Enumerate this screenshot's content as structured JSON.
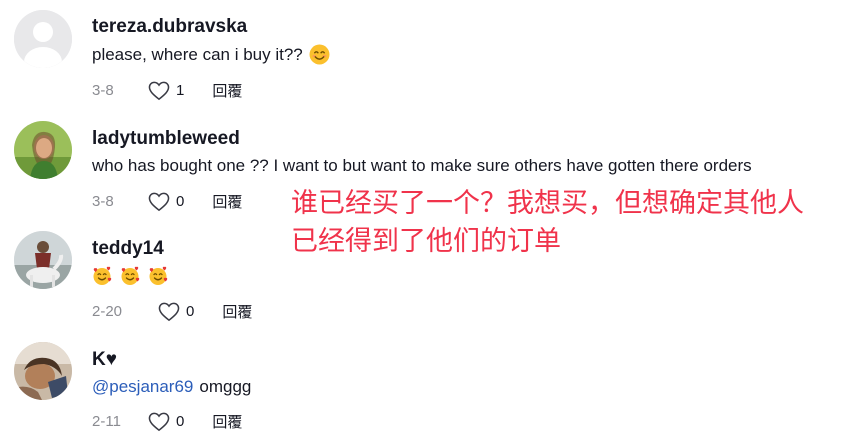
{
  "comments": [
    {
      "username": "tereza.dubravska",
      "text": "please, where can i buy it??",
      "emoji": "smiling-face-emoji",
      "date": "3-8",
      "likes": "1",
      "reply": "回覆"
    },
    {
      "username": "ladytumbleweed",
      "text": "who has bought one ?? I want to but want to make sure others have gotten there orders",
      "date": "3-8",
      "likes": "0",
      "reply": "回覆"
    },
    {
      "username": "teddy14",
      "emoji": "smiling-face-with-hearts-emoji",
      "emoji_count": 3,
      "date": "2-20",
      "likes": "0",
      "reply": "回覆"
    },
    {
      "username": "K♥",
      "mention": "@pesjanar69",
      "text": "omggg",
      "date": "2-11",
      "likes": "0",
      "reply": "回覆"
    }
  ],
  "annotation": {
    "line1": "谁已经买了一个？我想买，但想确定其他人",
    "line2": "已经得到了他们的订单",
    "color": "#f0334b"
  }
}
